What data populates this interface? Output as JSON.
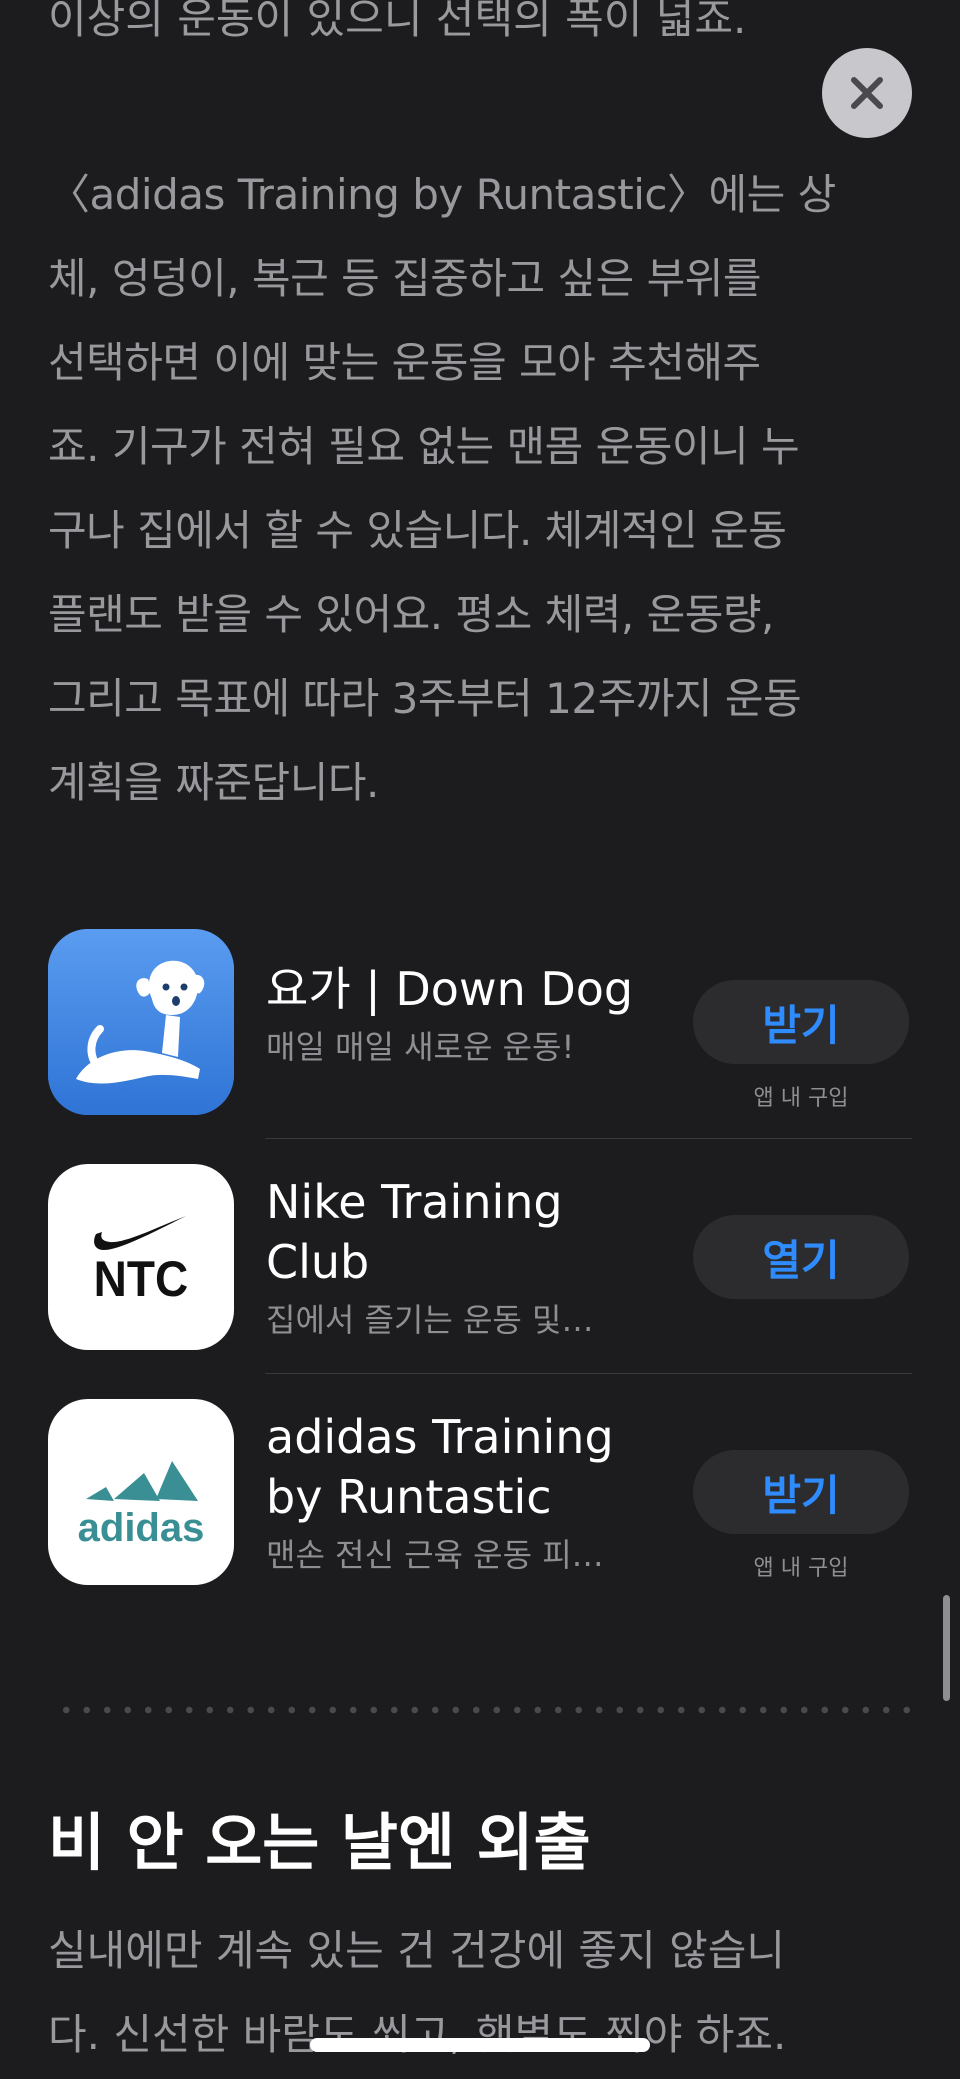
{
  "article": {
    "top_partial_line": "이상의 운동이 있으니 선택의 폭이 넓죠.",
    "paragraph_lines": [
      "〈adidas Training by Runtastic〉에는 상",
      "체, 엉덩이, 복근 등 집중하고 싶은 부위를",
      "선택하면 이에 맞는 운동을 모아 추천해주",
      "죠. 기구가 전혀 필요 없는 맨몸 운동이니 누",
      "구나 집에서 할 수 있습니다. 체계적인 운동",
      "플랜도 받을 수 있어요. 평소 체력, 운동량,",
      "그리고 목표에 따라 3주부터 12주까지 운동",
      "계획을 짜준답니다."
    ]
  },
  "close_button": {
    "icon": "close-icon"
  },
  "apps": [
    {
      "name": "요가 | Down Dog",
      "subtitle": "매일 매일 새로운 운동!",
      "button_label": "받기",
      "in_app_purchase": "앱 내 구입",
      "icon": "down-dog-icon",
      "icon_color": "#3f87e2"
    },
    {
      "name": "Nike Training Club",
      "subtitle": "집에서 즐기는 운동 및…",
      "button_label": "열기",
      "in_app_purchase": "",
      "icon": "nike-ntc-icon",
      "icon_text": "NTC",
      "icon_color": "#ffffff"
    },
    {
      "name": "adidas Training by Runtastic",
      "subtitle": "맨손 전신 근육 운동 피…",
      "button_label": "받기",
      "in_app_purchase": "앱 내 구입",
      "icon": "adidas-icon",
      "icon_text": "adidas",
      "icon_color": "#ffffff"
    }
  ],
  "next_section": {
    "title": "비 안 오는 날엔 외출",
    "body_lines": [
      "실내에만 계속 있는 건 건강에 좋지 않습니",
      "다. 신선한 바람도 쐬고, 햇볕도 쬐야 하죠."
    ]
  },
  "colors": {
    "background": "#1c1c1e",
    "accent": "#2f8cff",
    "button_bg": "#2c2c2e",
    "secondary_text": "#8e8e93"
  }
}
